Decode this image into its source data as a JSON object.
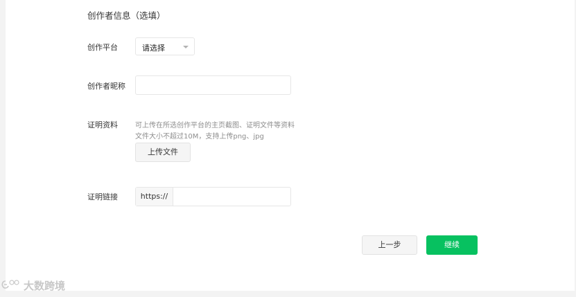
{
  "section": {
    "title": "创作者信息（选填）"
  },
  "fields": {
    "platform": {
      "label": "创作平台",
      "value": "请选择"
    },
    "nickname": {
      "label": "创作者昵称",
      "value": ""
    },
    "proof_material": {
      "label": "证明资料",
      "hint_line1": "可上传在所选创作平台的主页截图、证明文件等资料",
      "hint_line2": "文件大小不超过10M，支持上传png、jpg",
      "upload_label": "上传文件"
    },
    "proof_link": {
      "label": "证明链接",
      "prefix": "https://",
      "value": ""
    }
  },
  "actions": {
    "prev_label": "上一步",
    "continue_label": "继续"
  },
  "watermark": {
    "text": "大数跨境"
  },
  "colors": {
    "primary": "#07c160",
    "background": "#f3f3f3",
    "panel": "#ffffff"
  }
}
